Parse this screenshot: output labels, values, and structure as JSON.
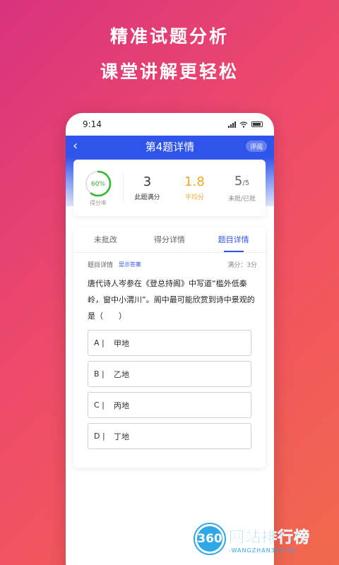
{
  "headline": {
    "line1": "精准试题分析",
    "line2": "课堂讲解更轻松"
  },
  "status_bar": {
    "time": "9:14"
  },
  "nav": {
    "back_glyph": "‹",
    "title": "第4题详情",
    "badge": "评阅"
  },
  "stats": {
    "ring_percent": "60%",
    "ring_value": 0.6,
    "ring_label": "得分率",
    "full_score_count": "3",
    "full_score_label": "此题满分",
    "average": "1.8",
    "average_label": "平均分",
    "marked": "5",
    "marked_total": "/5",
    "marked_label": "未批/已批"
  },
  "tabs": [
    {
      "label": "未批改"
    },
    {
      "label": "得分详情"
    },
    {
      "label": "题目详情"
    }
  ],
  "detail": {
    "section_label": "题目详情",
    "show_answer": "显示答案",
    "score": "满分：3分",
    "question": "唐代诗人岑参在《登总持阁》中写道“槛外低秦岭，窗中小渭川”。阁中最可能欣赏到诗中景观的是（　　）"
  },
  "options": [
    {
      "letter": "A |",
      "text": "甲地"
    },
    {
      "letter": "B |",
      "text": "乙地"
    },
    {
      "letter": "C |",
      "text": "丙地"
    },
    {
      "letter": "D |",
      "text": "丁地"
    }
  ],
  "watermark": {
    "logo": "360",
    "name": "网站排行榜",
    "domain": "-WANGZHAN360.CN"
  },
  "colors": {
    "accent": "#2f54eb",
    "ring": "#2eb82e",
    "average": "#f5a623"
  }
}
